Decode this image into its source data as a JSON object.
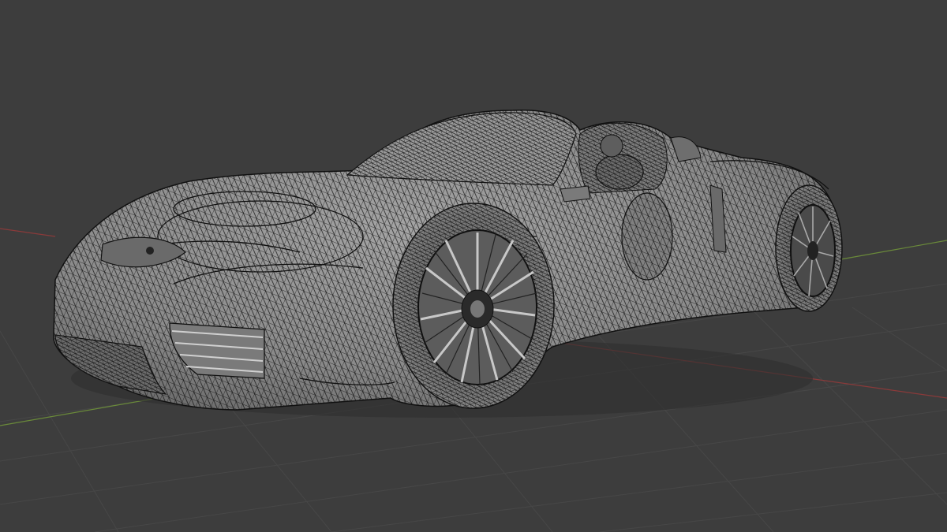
{
  "viewport": {
    "background_color": "#3d3d3d",
    "grid_color": "#4a4a4a",
    "x_axis_color": "#8a3a3a",
    "y_axis_color": "#6a8a3a",
    "mesh_fill_color": "#8e8e8e",
    "mesh_shadow_color": "#6e6e6e",
    "wire_color": "#111111",
    "highlight_color": "#b4b4b4",
    "grid_visible": true,
    "shading_mode": "solid",
    "overlay": "wireframe"
  },
  "scene_object": {
    "name_icon": "car-mesh",
    "wheel_icon": "wheel-mesh"
  }
}
